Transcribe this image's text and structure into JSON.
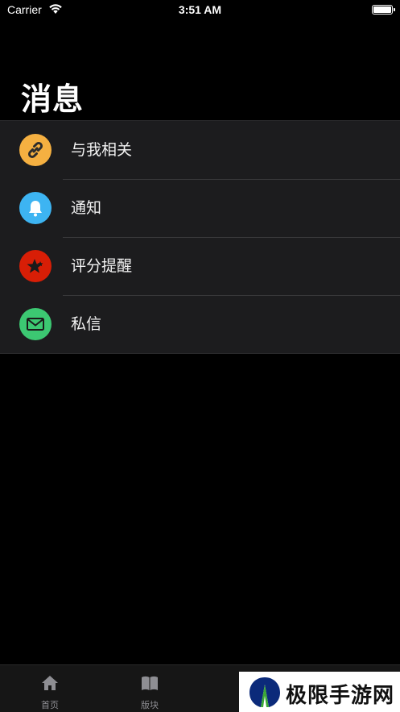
{
  "status_bar": {
    "carrier": "Carrier",
    "time": "3:51 AM"
  },
  "page": {
    "title": "消息"
  },
  "menu": {
    "items": [
      {
        "label": "与我相关",
        "icon": "link-icon",
        "color": "#F5B041"
      },
      {
        "label": "通知",
        "icon": "bell-icon",
        "color": "#3DB4F2"
      },
      {
        "label": "评分提醒",
        "icon": "star-icon",
        "color": "#D81E06"
      },
      {
        "label": "私信",
        "icon": "mail-icon",
        "color": "#3CC872"
      }
    ]
  },
  "tab_bar": {
    "tabs": [
      {
        "label": "首页",
        "icon": "home-icon"
      },
      {
        "label": "版块",
        "icon": "book-icon"
      }
    ]
  },
  "watermark": {
    "text": "极限手游网"
  }
}
